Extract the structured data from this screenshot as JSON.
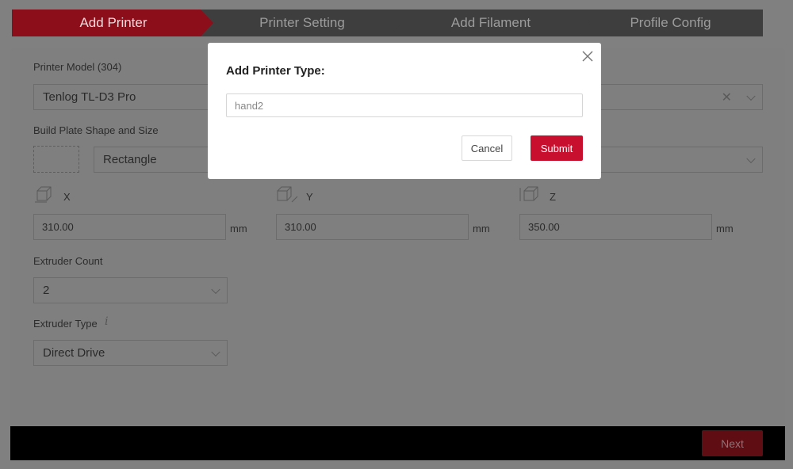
{
  "stepper": {
    "steps": [
      {
        "label": "Add Printer"
      },
      {
        "label": "Printer Setting"
      },
      {
        "label": "Add Filament"
      },
      {
        "label": "Profile Config"
      }
    ],
    "active_index": 0,
    "active_color": "#8b0e1a",
    "inactive_color": "#3e3e3e"
  },
  "form": {
    "printer_model_label": "Printer Model (304)",
    "printer_model_value": "Tenlog TL-D3 Pro",
    "build_plate_label": "Build Plate Shape and Size",
    "build_plate_shape": "Rectangle",
    "axes": [
      {
        "label": "X",
        "value": "310.00",
        "unit": "mm"
      },
      {
        "label": "Y",
        "value": "310.00",
        "unit": "mm"
      },
      {
        "label": "Z",
        "value": "350.00",
        "unit": "mm"
      }
    ],
    "extruder_count_label": "Extruder Count",
    "extruder_count_value": "2",
    "extruder_type_label": "Extruder Type",
    "extruder_type_info_icon": "i",
    "extruder_type_value": "Direct Drive"
  },
  "footer": {
    "next_label": "Next"
  },
  "modal": {
    "title": "Add Printer Type:",
    "input_value": "hand2",
    "cancel_label": "Cancel",
    "submit_label": "Submit",
    "close_icon": "close-icon",
    "accent_color": "#c8102e"
  }
}
